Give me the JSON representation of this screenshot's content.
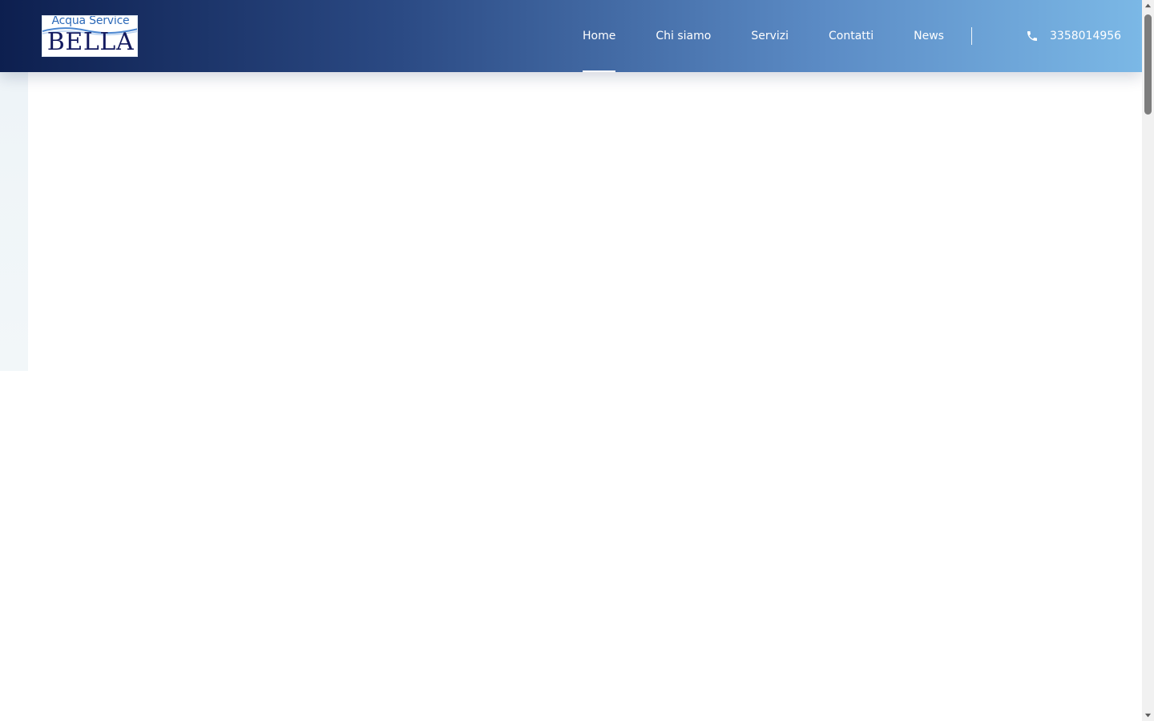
{
  "header": {
    "logo": {
      "top_text": "Acqua Service",
      "main_text": "BELLA"
    },
    "nav": [
      {
        "label": "Home",
        "active": true
      },
      {
        "label": "Chi siamo",
        "active": false
      },
      {
        "label": "Servizi",
        "active": false
      },
      {
        "label": "Contatti",
        "active": false
      },
      {
        "label": "News",
        "active": false
      }
    ],
    "phone": {
      "icon": "phone-icon",
      "number": "3358014956"
    }
  },
  "colors": {
    "header_start": "#0d1f4f",
    "header_end": "#7bb8e6",
    "logo_blue": "#2c69b8",
    "logo_navy": "#131a5f"
  }
}
